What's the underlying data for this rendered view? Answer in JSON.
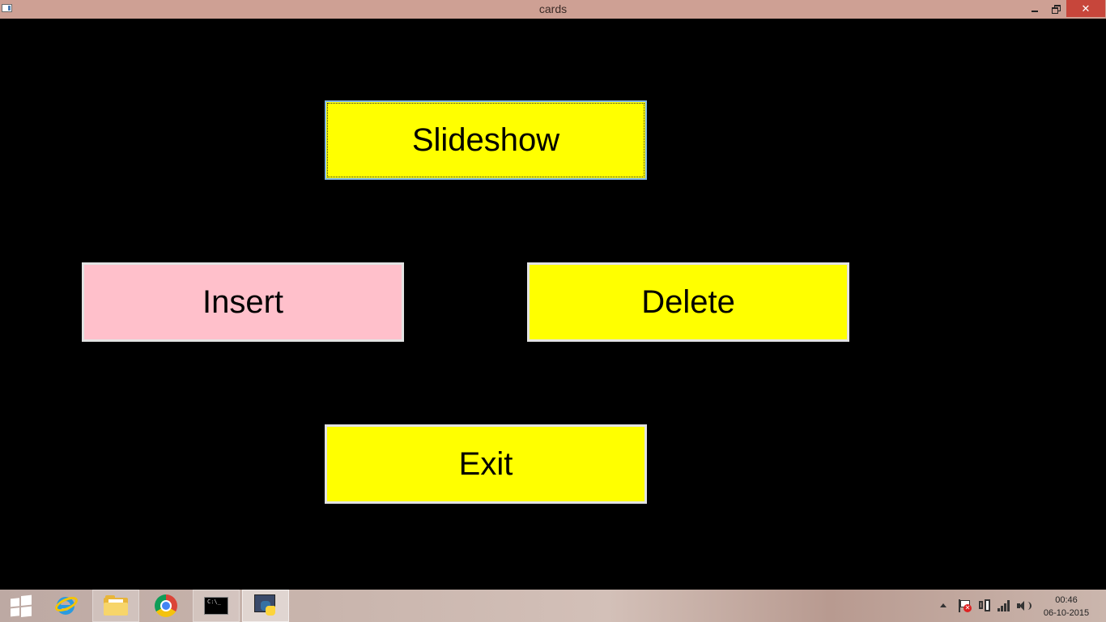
{
  "window": {
    "title": "cards",
    "controls": {
      "minimize_icon": "minimize-icon",
      "restore_icon": "restore-icon",
      "close_label": "✕"
    }
  },
  "menu": {
    "slideshow_label": "Slideshow",
    "insert_label": "Insert",
    "delete_label": "Delete",
    "exit_label": "Exit",
    "colors": {
      "background": "#000000",
      "yellow": "#ffff00",
      "pink": "#ffc0cb",
      "focus_border": "#7fb8e6"
    }
  },
  "taskbar": {
    "pinned": [
      {
        "name": "windows-start",
        "icon": "windows-logo-icon"
      },
      {
        "name": "internet-explorer",
        "icon": "internet-explorer-icon"
      },
      {
        "name": "file-explorer",
        "icon": "folder-icon"
      },
      {
        "name": "chrome",
        "icon": "chrome-icon"
      },
      {
        "name": "command-prompt",
        "icon": "command-prompt-icon",
        "label": "C:\\_"
      },
      {
        "name": "python",
        "icon": "python-icon"
      }
    ],
    "tray": {
      "icons": [
        "chevron-up-icon",
        "action-center-flag-icon",
        "power-icon",
        "network-signal-icon",
        "volume-icon"
      ]
    },
    "clock": {
      "time": "00:46",
      "date": "06-10-2015"
    }
  }
}
